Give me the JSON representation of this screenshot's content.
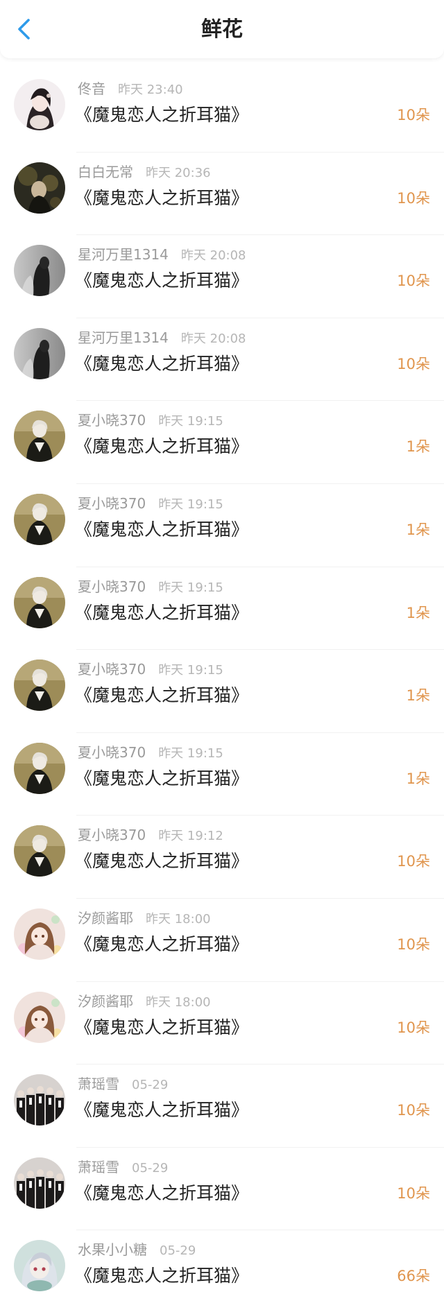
{
  "header": {
    "title": "鲜花"
  },
  "colors": {
    "accent_blue": "#2f9bea",
    "amount_orange": "#e0954d",
    "meta_gray": "#9a9a9a",
    "text_dark": "#222222"
  },
  "icons": {
    "back": "chevron-left-icon"
  },
  "records": [
    {
      "user": "佟音",
      "time": "昨天 23:40",
      "book": "《魔鬼恋人之折耳猫》",
      "amount": "10朵",
      "avatar": "a1"
    },
    {
      "user": "白白无常",
      "time": "昨天 20:36",
      "book": "《魔鬼恋人之折耳猫》",
      "amount": "10朵",
      "avatar": "a2"
    },
    {
      "user": "星河万里1314",
      "time": "昨天 20:08",
      "book": "《魔鬼恋人之折耳猫》",
      "amount": "10朵",
      "avatar": "a3"
    },
    {
      "user": "星河万里1314",
      "time": "昨天 20:08",
      "book": "《魔鬼恋人之折耳猫》",
      "amount": "10朵",
      "avatar": "a3"
    },
    {
      "user": "夏小晓370",
      "time": "昨天 19:15",
      "book": "《魔鬼恋人之折耳猫》",
      "amount": "1朵",
      "avatar": "a4"
    },
    {
      "user": "夏小晓370",
      "time": "昨天 19:15",
      "book": "《魔鬼恋人之折耳猫》",
      "amount": "1朵",
      "avatar": "a4"
    },
    {
      "user": "夏小晓370",
      "time": "昨天 19:15",
      "book": "《魔鬼恋人之折耳猫》",
      "amount": "1朵",
      "avatar": "a4"
    },
    {
      "user": "夏小晓370",
      "time": "昨天 19:15",
      "book": "《魔鬼恋人之折耳猫》",
      "amount": "1朵",
      "avatar": "a4"
    },
    {
      "user": "夏小晓370",
      "time": "昨天 19:15",
      "book": "《魔鬼恋人之折耳猫》",
      "amount": "1朵",
      "avatar": "a4"
    },
    {
      "user": "夏小晓370",
      "time": "昨天 19:12",
      "book": "《魔鬼恋人之折耳猫》",
      "amount": "10朵",
      "avatar": "a4"
    },
    {
      "user": "汐颜酱耶",
      "time": "昨天 18:00",
      "book": "《魔鬼恋人之折耳猫》",
      "amount": "10朵",
      "avatar": "a5"
    },
    {
      "user": "汐颜酱耶",
      "time": "昨天 18:00",
      "book": "《魔鬼恋人之折耳猫》",
      "amount": "10朵",
      "avatar": "a5"
    },
    {
      "user": "萧瑶雪",
      "time": "05-29",
      "book": "《魔鬼恋人之折耳猫》",
      "amount": "10朵",
      "avatar": "a6"
    },
    {
      "user": "萧瑶雪",
      "time": "05-29",
      "book": "《魔鬼恋人之折耳猫》",
      "amount": "10朵",
      "avatar": "a6"
    },
    {
      "user": "水果小小糖",
      "time": "05-29",
      "book": "《魔鬼恋人之折耳猫》",
      "amount": "66朵",
      "avatar": "a7"
    }
  ]
}
